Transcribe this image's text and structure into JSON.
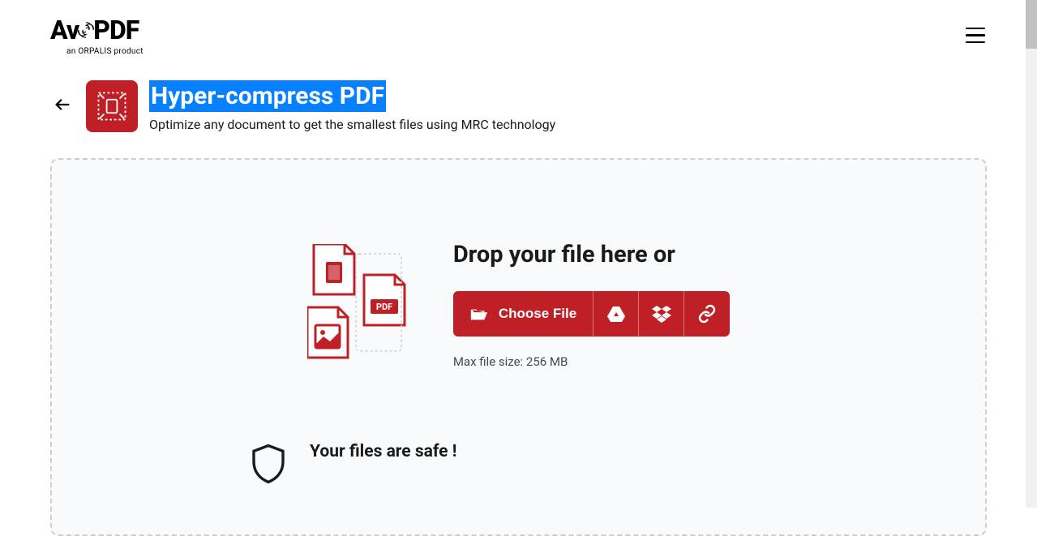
{
  "logo": {
    "main": "AvePDF",
    "sub": "an ORPALIS product"
  },
  "tool": {
    "title": "Hyper-compress PDF",
    "subtitle": "Optimize any document to get the smallest files using MRC technology"
  },
  "dropzone": {
    "heading": "Drop your file here or",
    "choose_file_label": "Choose File",
    "max_size_label": "Max file size: 256 MB"
  },
  "safe": {
    "heading": "Your files are safe !"
  },
  "icons": {
    "back": "back-arrow",
    "menu": "hamburger-menu",
    "compress": "compress-tool",
    "folder": "folder-open",
    "gdrive": "google-drive",
    "dropbox": "dropbox",
    "link": "url-link",
    "shield": "security-shield"
  }
}
